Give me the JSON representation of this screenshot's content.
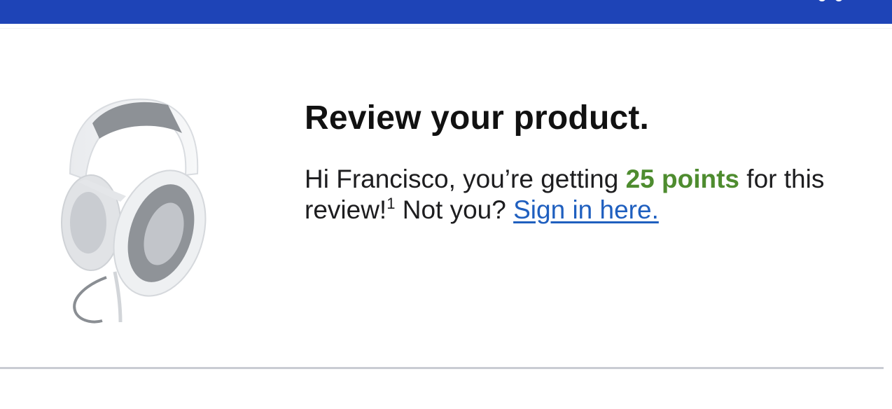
{
  "header": {
    "bar_color": "#1e44b7",
    "icon": "account-icon"
  },
  "product": {
    "image_icon": "headset-image"
  },
  "review": {
    "title": "Review your product.",
    "greeting": "Hi Francisco, you’re getting ",
    "points": "25 points",
    "after_points": " for this review!",
    "footnote": "1",
    "not_you": " Not you? ",
    "sign_in_link": "Sign in here."
  },
  "colors": {
    "accent_green": "#4e8c2f",
    "link_blue": "#1f5fbf",
    "divider": "#c9ccd3"
  }
}
